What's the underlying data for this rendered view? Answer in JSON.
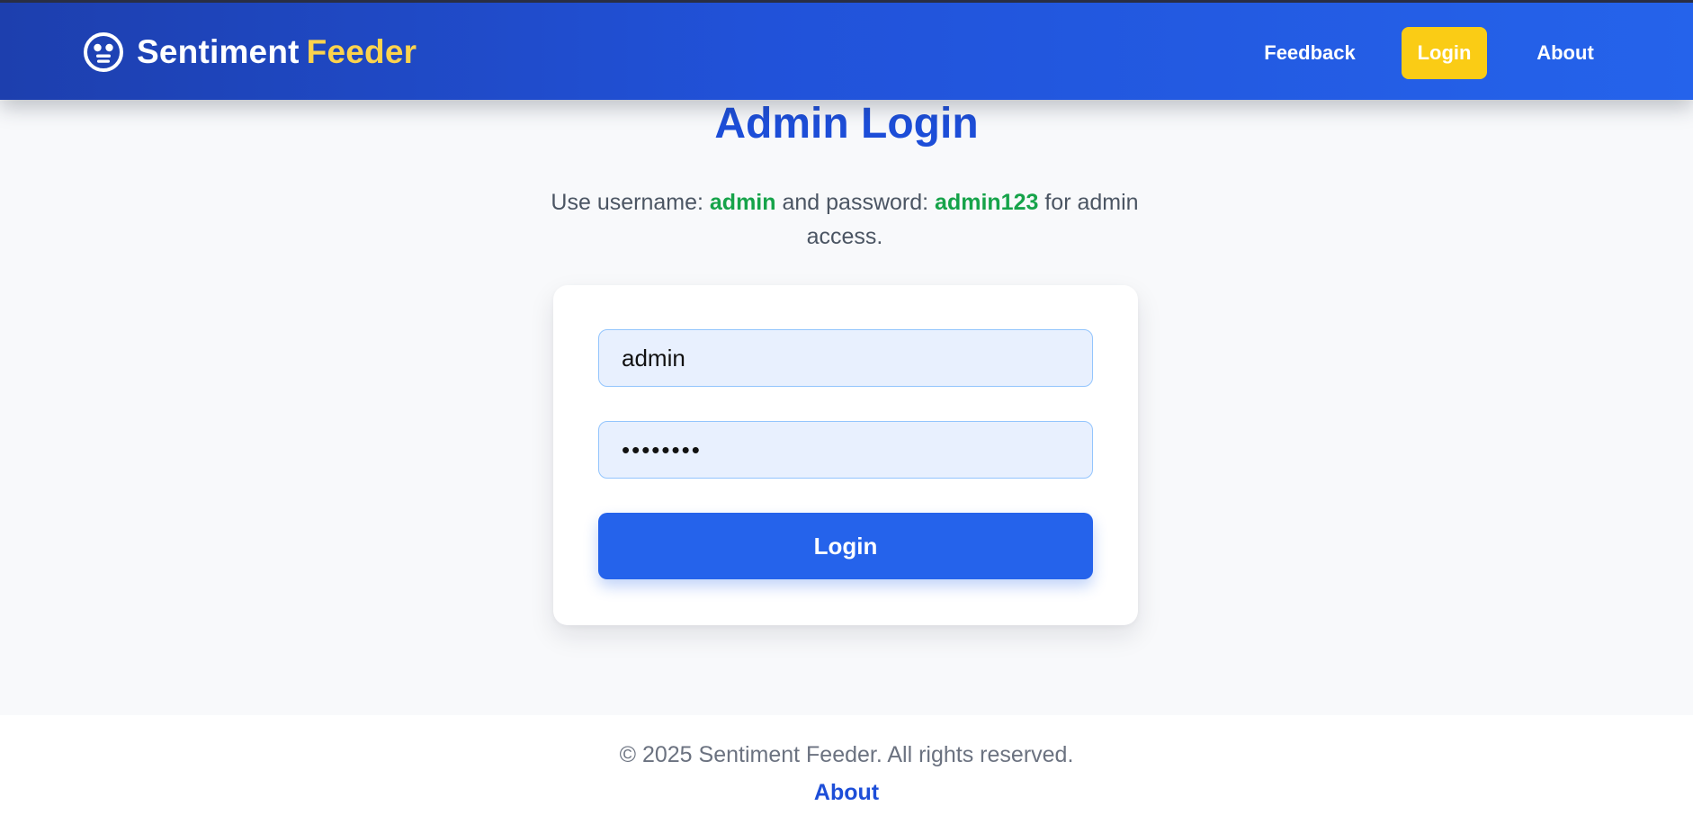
{
  "header": {
    "brand_name": "Sentiment",
    "brand_accent": "Feeder",
    "brand_icon": "emoji-face-icon",
    "nav": {
      "feedback": "Feedback",
      "login": "Login",
      "about": "About"
    }
  },
  "main": {
    "title": "Admin Login",
    "hint": {
      "prefix": "Use username:",
      "username": "admin",
      "middle": "and password:",
      "password": "admin123",
      "suffix": "for admin access."
    },
    "form": {
      "username_value": "admin",
      "password_value": "admin123",
      "submit_label": "Login"
    }
  },
  "footer": {
    "copyright": "© 2025 Sentiment Feeder. All rights reserved.",
    "about_link": "About"
  },
  "colors": {
    "primary": "#2563eb",
    "header_start": "#1d3fae",
    "accent_yellow": "#facc15",
    "brand_accent_text": "#fcd34d",
    "credential_green": "#16a34a",
    "title_blue": "#1d4ed8",
    "input_bg": "#e8f0fe"
  }
}
